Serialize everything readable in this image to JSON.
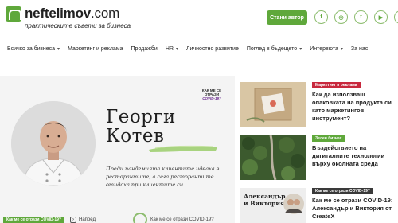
{
  "header": {
    "logo_name": "neftelimov",
    "logo_domain": ".com",
    "tagline": "практическите съвети за бизнеса",
    "cta_label": "Стани автор",
    "social_icons": [
      "facebook-icon",
      "instagram-icon",
      "twitter-icon",
      "youtube-icon",
      "linkedin-icon"
    ],
    "social_glyphs": [
      "f",
      "◎",
      "t",
      "▶",
      "in"
    ]
  },
  "nav": {
    "items": [
      {
        "label": "Всичко за бизнеса",
        "has_dropdown": true
      },
      {
        "label": "Маркетинг и реклама",
        "has_dropdown": false
      },
      {
        "label": "Продажби",
        "has_dropdown": false
      },
      {
        "label": "HR",
        "has_dropdown": true
      },
      {
        "label": "Личностно развитие",
        "has_dropdown": false
      },
      {
        "label": "Поглед в бъдещето",
        "has_dropdown": true
      },
      {
        "label": "Интервюта",
        "has_dropdown": true
      },
      {
        "label": "За нас",
        "has_dropdown": false
      }
    ]
  },
  "hero": {
    "name_line1": "Георги",
    "name_line2": "Котев",
    "quote": "Преди пандемията клиентите идваха в ресторантите, а сега ресторантите отидоха при клиентите си.",
    "badge_line1": "КАК МЕ СЕ",
    "badge_line2": "ОТРАЗИ",
    "badge_line3": "COVID-19?",
    "category": "Как ме се отрази COVID-19?",
    "next_label": "Напред",
    "teaser_label": "Как ме се отрази COVID-19?"
  },
  "articles": [
    {
      "category": "Маркетинг и реклама",
      "category_color": "#c8283d",
      "title": "Как да използваш опаковката на продукта си като маркетингов инструмент?"
    },
    {
      "category": "Зелен бизнес",
      "category_color": "#5fa83b",
      "title": "Въздействието на дигиталните технологии върху околната среда"
    },
    {
      "category": "Как ме се отрази COVID-19?",
      "category_color": "#3a3a3a",
      "title": "Как ме се отрази COVID-19: Александър и Виктория от CreateX",
      "thumb_text_line1": "Александър",
      "thumb_text_line2": "и Виктория"
    }
  ],
  "colors": {
    "brand_green": "#5fa83b",
    "accent_red": "#c8283d",
    "covid_purple": "#6b2b8f"
  }
}
